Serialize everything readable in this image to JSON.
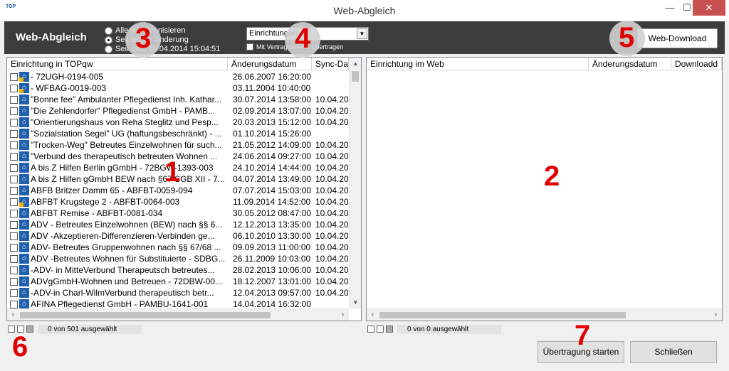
{
  "window": {
    "title": "Web-Abgleich",
    "app_icon": "TOP"
  },
  "toolbar": {
    "title": "Web-Abgleich",
    "radios": [
      {
        "label": "Alle synchronisieren",
        "selected": false
      },
      {
        "label": "Seit letzter Änderung",
        "selected": true
      },
      {
        "label": "Seit dem 10.04.2014 15:04:51",
        "selected": false
      }
    ],
    "select_value": "Einrichtungen",
    "checkbox_label": "Mit Vertrag ohne ... übertragen",
    "download_button": "Web-Download"
  },
  "left": {
    "headers": [
      "Einrichtung in TOPqw",
      "Änderungsdatum",
      "Sync-Da"
    ],
    "rows": [
      {
        "name": " - 72UGH-0194-005",
        "date": "26.06.2007 16:20:00",
        "sync": "",
        "warn": true
      },
      {
        "name": " - WFBAG-0019-003",
        "date": "03.11.2004 10:40:00",
        "sync": "",
        "warn": true
      },
      {
        "name": "\"Bonne fee\" Ambulanter Pflegedienst Inh. Kathar...",
        "date": "30.07.2014 13:58:00",
        "sync": "10.04.20",
        "warn": false
      },
      {
        "name": "\"Die Zehlendorfer\" Pflegedienst GmbH - PAMB...",
        "date": "02.09.2014 13:07:00",
        "sync": "10.04.20",
        "warn": false
      },
      {
        "name": "\"Orientierungshaus von Reha Steglitz und Pesp...",
        "date": "20.03.2013 15:12:00",
        "sync": "10.04.20",
        "warn": false
      },
      {
        "name": "\"Sozialstation Segel\" UG (haftungsbeschränkt) - ...",
        "date": "01.10.2014 15:26:00",
        "sync": "",
        "warn": false
      },
      {
        "name": "\"Trocken-Weg\" Betreutes Einzelwohnen für such...",
        "date": "21.05.2012 14:09:00",
        "sync": "10.04.20",
        "warn": false
      },
      {
        "name": "\"Verbund des therapeutisch betreuten Wohnen ...",
        "date": "24.06.2014 09:27:00",
        "sync": "10.04.20",
        "warn": false
      },
      {
        "name": "A bis Z Hilfen Berlin gGmbH - 72BGW-1393-003",
        "date": "24.10.2014 14:44:00",
        "sync": "10.04.20",
        "warn": false
      },
      {
        "name": "A bis Z Hilfen gGmbH BEW nach §67 SGB XII - 7...",
        "date": "04.07.2014 13:49:00",
        "sync": "10.04.20",
        "warn": false
      },
      {
        "name": "ABFB Britzer Damm 65 - ABFBT-0059-094",
        "date": "07.07.2014 15:03:00",
        "sync": "10.04.20",
        "warn": false
      },
      {
        "name": "ABFBT Krugstege 2 - ABFBT-0064-003",
        "date": "11.09.2014 14:52:00",
        "sync": "10.04.20",
        "warn": true
      },
      {
        "name": "ABFBT Remise - ABFBT-0081-034",
        "date": "30.05.2012 08:47:00",
        "sync": "10.04.20",
        "warn": false
      },
      {
        "name": "ADV - Betreutes Einzelwohnen  (BEW) nach §§ 6...",
        "date": "12.12.2013 13:35:00",
        "sync": "10.04.20",
        "warn": false
      },
      {
        "name": "ADV -Akzeptieren-Differenzieren-Verbinden ge...",
        "date": "06.10.2010 13:30:00",
        "sync": "10.04.20",
        "warn": false
      },
      {
        "name": "ADV- Betreutes Gruppenwohnen nach §§ 67/68 ...",
        "date": "09.09.2013 11:00:00",
        "sync": "10.04.20",
        "warn": false
      },
      {
        "name": "ADV -Betreutes Wohnen für Substituierte - SDBG...",
        "date": "26.11.2009 10:03:00",
        "sync": "10.04.20",
        "warn": false
      },
      {
        "name": "-ADV- in MitteVerbund Therapeutsch betreutes...",
        "date": "28.02.2013 10:06:00",
        "sync": "10.04.20",
        "warn": false
      },
      {
        "name": "ADVgGmbH-Wohnen und Betreuen - 72DBW-00...",
        "date": "18.12.2007 13:01:00",
        "sync": "10.04.20",
        "warn": false
      },
      {
        "name": "-ADV-in Charl-WilmVerbund therapeutisch betr...",
        "date": "12.04.2013 09:57:00",
        "sync": "10.04.20",
        "warn": false
      },
      {
        "name": "AFINA Pflegedienst GmbH - PAMBU-1641-001",
        "date": "14.04.2014 16:32:00",
        "sync": "",
        "warn": false
      }
    ],
    "status": "0 von 501 ausgewählt"
  },
  "right": {
    "headers": [
      "Einrichtung im Web",
      "Änderungsdatum",
      "Downloadd"
    ],
    "status": "0 von 0 ausgewählt"
  },
  "buttons": {
    "start": "Übertragung starten",
    "close": "Schließen"
  },
  "callouts": [
    "1",
    "2",
    "3",
    "4",
    "5",
    "6",
    "7"
  ]
}
